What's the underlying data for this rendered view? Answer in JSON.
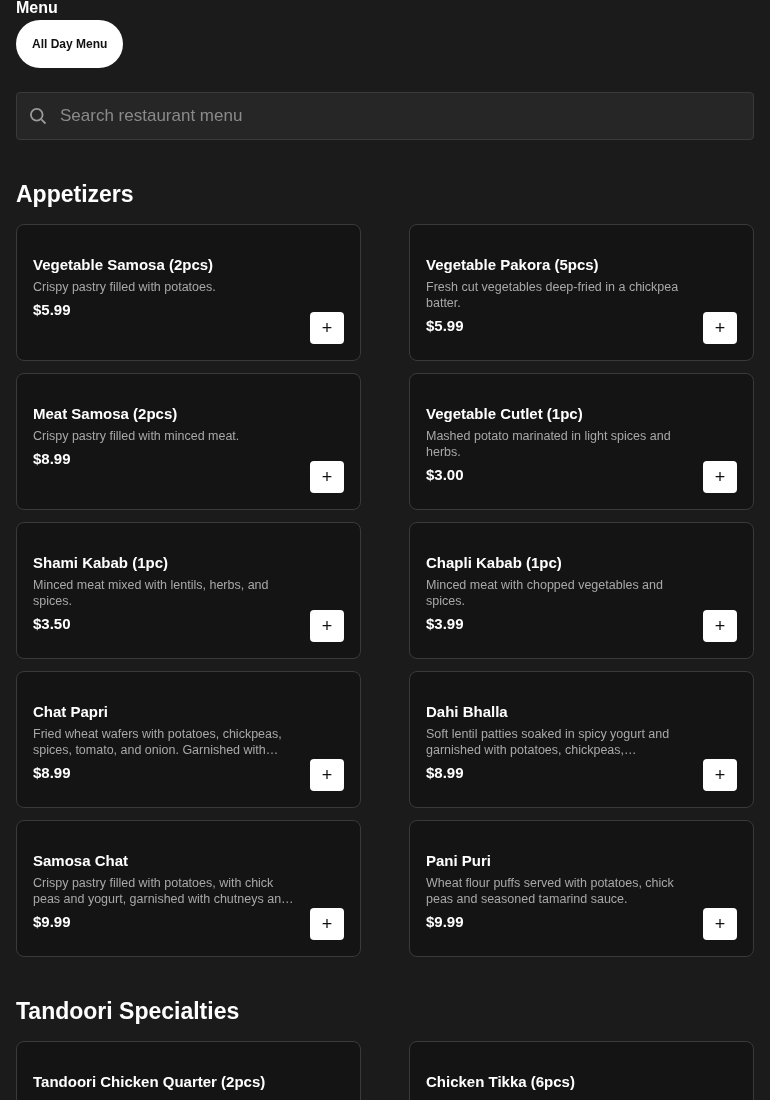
{
  "heading": "Menu",
  "menus": [
    {
      "label": "All Day Menu",
      "selected": true
    }
  ],
  "search": {
    "placeholder": "Search restaurant menu"
  },
  "sections": [
    {
      "title": "Appetizers",
      "items": [
        {
          "name": "Vegetable Samosa (2pcs)",
          "description": "Crispy pastry filled with potatoes.",
          "price": "$5.99",
          "button": "+"
        },
        {
          "name": "Vegetable Pakora (5pcs)",
          "description": "Fresh cut vegetables deep-fried in a chickpea batter.",
          "price": "$5.99",
          "button": "+"
        },
        {
          "name": "Meat Samosa (2pcs)",
          "description": "Crispy pastry filled with minced meat.",
          "price": "$8.99",
          "button": "+"
        },
        {
          "name": "Vegetable Cutlet (1pc)",
          "description": "Mashed potato marinated in light spices and herbs.",
          "price": "$3.00",
          "button": "+"
        },
        {
          "name": "Shami Kabab (1pc)",
          "description": "Minced meat mixed with lentils, herbs, and spices.",
          "price": "$3.50",
          "button": "+"
        },
        {
          "name": "Chapli Kabab (1pc)",
          "description": "Minced meat with chopped vegetables and spices.",
          "price": "$3.99",
          "button": "+"
        },
        {
          "name": "Chat Papri",
          "description": "Fried wheat wafers with potatoes, chickpeas, spices, tomato, and onion. Garnished with…",
          "price": "$8.99",
          "button": "+"
        },
        {
          "name": "Dahi Bhalla",
          "description": "Soft lentil patties soaked in spicy yogurt and garnished with potatoes, chickpeas,…",
          "price": "$8.99",
          "button": "+"
        },
        {
          "name": "Samosa Chat",
          "description": "Crispy pastry filled with potatoes, with chick peas and yogurt, garnished with chutneys an…",
          "price": "$9.99",
          "button": "+"
        },
        {
          "name": "Pani Puri",
          "description": "Wheat flour puffs served with potatoes, chick peas and seasoned tamarind sauce.",
          "price": "$9.99",
          "button": "+"
        }
      ]
    },
    {
      "title": "Tandoori Specialties",
      "items": [
        {
          "name": "Tandoori Chicken Quarter (2pcs)"
        },
        {
          "name": "Chicken Tikka (6pcs)"
        }
      ]
    }
  ]
}
